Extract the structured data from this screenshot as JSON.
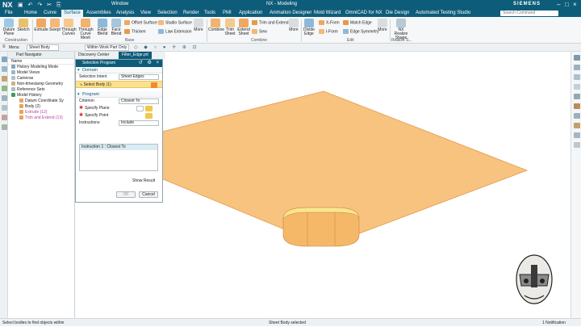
{
  "titlebar": {
    "logo": "NX",
    "window_menu": "Window",
    "title": "NX - Modeling",
    "brand": "SIEMENS",
    "accent": "#0d5c7a"
  },
  "menu": {
    "tabs": [
      "File",
      "Home",
      "Curve",
      "Surface",
      "Assemblies",
      "Analysis",
      "View",
      "Selection",
      "Render",
      "Tools",
      "PMI",
      "Application",
      "Animation Designer",
      "Mold Wizard",
      "OmniCAD for NX",
      "Die Design",
      "Automated Testing Studio"
    ],
    "active": "Surface",
    "search_placeholder": "Search Command"
  },
  "ribbon": {
    "datum_plane": "Datum Plane",
    "sketch": "Sketch",
    "extrude": "Extrude",
    "swept": "Swept",
    "through_curves": "Through Curves",
    "through_curve_mesh": "Through Curve Mesh",
    "edge_blend": "Edge Blend",
    "face_blend": "Face Blend",
    "offset_surface": "Offset Surface",
    "studio_surface": "Studio Surface",
    "thicken": "Thicken",
    "law_extension": "Law Extension",
    "more1": "More",
    "combine": "Combine",
    "trim_sheet": "Trim Sheet",
    "extend_sheet": "Extend Sheet",
    "trim_and_extend": "Trim and Extend",
    "sew": "Sew",
    "more2": "More",
    "divide_edge": "Divide Edge",
    "x_form": "X-Form",
    "i_form": "I-Form",
    "match_edge": "Match Edge",
    "edge_symmetry": "Edge Symmetry",
    "more3": "More",
    "nx_realize_shape": "NX Realize Shape",
    "groups": {
      "construction": "Construction",
      "base": "Base",
      "combine": "Combine",
      "edit": "Edit",
      "realize": "Realize S..."
    }
  },
  "selbar": {
    "menu": "Menu",
    "filter": "Sheet Body",
    "scope": "Within Work Part Only"
  },
  "nav": {
    "title": "Part Navigator",
    "column": "Name",
    "items": [
      "History Modeling Mode",
      "Model Views",
      "Cameras",
      "Non-timestamp Geometry",
      "Reference Sets",
      "Model History",
      "Datum Coordinate Sy",
      "Body (2)",
      "Extrude (12)",
      "Trim and Extend (13)"
    ]
  },
  "graph_tabs": {
    "tab1": "Discovery Center",
    "tab2": "Filter_Edge.prt"
  },
  "dialog": {
    "title": "Selection Program",
    "domain_section": "Domain",
    "selection_intent_label": "Selection Intent",
    "selection_intent_value": "Sheet Edges",
    "select_body": "Select Body (1)",
    "program_section": "Program",
    "criterion_label": "Criterion",
    "criterion_value": "Closest To",
    "specify_plane": "Specify Plane",
    "specify_point": "Specify Point",
    "instructions_label": "Instructions",
    "instructions_value": "Include",
    "instruction_item": "Instruction 1 : Closest To",
    "show_result": "Show Result",
    "ok": "OK",
    "cancel": "Cancel"
  },
  "status": {
    "left": "Select bodies to find objects within",
    "center": "Sheet Body selected",
    "right": "1 Notification"
  },
  "colors": {
    "sheet": "#f8c27f",
    "sheet_edge": "#e09a4e",
    "selection": "#fde08a"
  }
}
